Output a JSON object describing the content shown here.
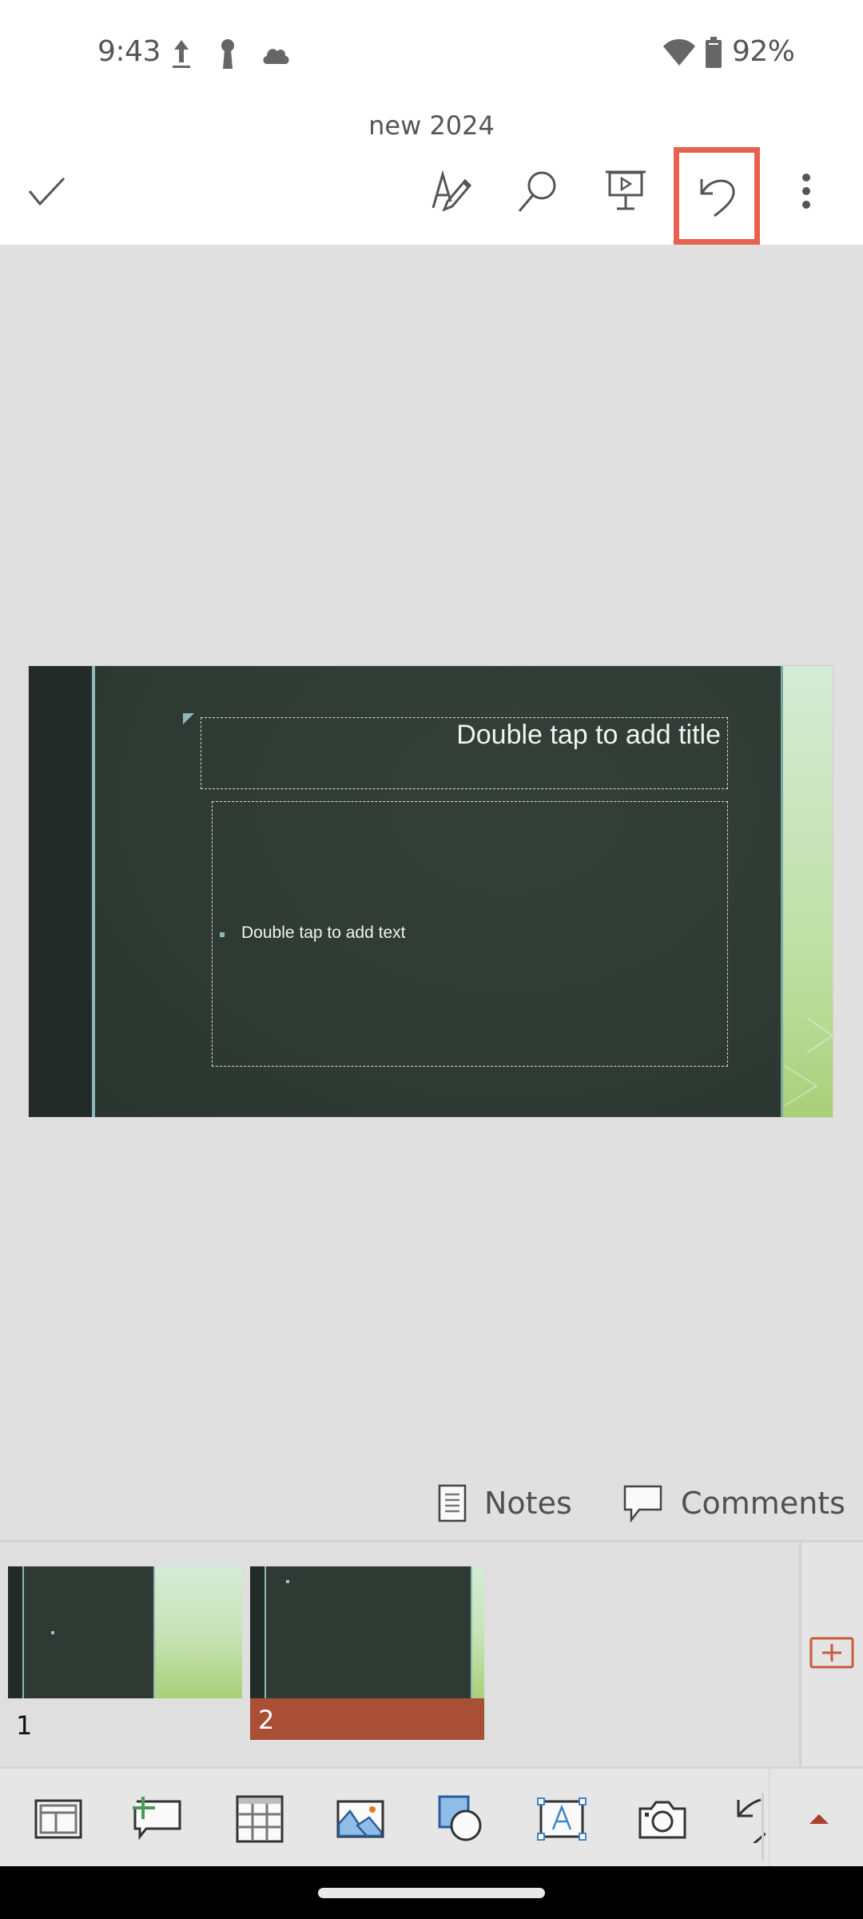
{
  "status_bar": {
    "time": "9:43",
    "notification_icons": [
      "upload-icon",
      "keyhole-icon",
      "cloud-icon"
    ],
    "wifi_icon": "wifi-icon",
    "battery_icon": "battery-icon",
    "battery_percent": "92%"
  },
  "header": {
    "document_title": "new 2024",
    "toolbar": {
      "done": "checkmark-icon",
      "draw": "draw-pen-icon",
      "find": "search-icon",
      "present": "present-icon",
      "undo": "undo-icon",
      "more": "more-vertical-icon"
    },
    "highlight_color": "#e8614f"
  },
  "slide": {
    "title_placeholder": "Double tap to add title",
    "body_placeholder": "Double tap to add text"
  },
  "notes_comments": {
    "notes_label": "Notes",
    "comments_label": "Comments"
  },
  "thumbnails": {
    "slides": [
      {
        "number": "1",
        "selected": false
      },
      {
        "number": "2",
        "selected": true
      }
    ],
    "selected_color": "#a84f36",
    "add_slide_icon": "add-slide-icon"
  },
  "insert_toolbar": {
    "items": [
      "layout-icon",
      "new-comment-icon",
      "table-icon",
      "picture-icon",
      "shapes-icon",
      "text-box-icon",
      "camera-icon",
      "ink-icon"
    ],
    "expand_icon": "expand-up-icon"
  }
}
